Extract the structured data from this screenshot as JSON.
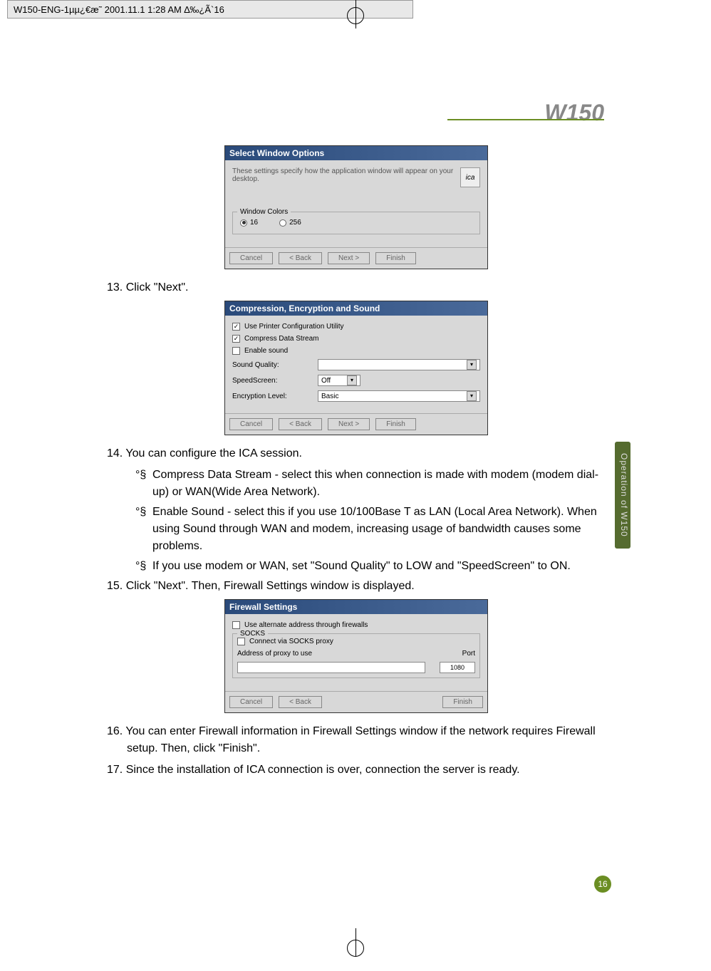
{
  "header": {
    "filename": "W150-ENG-1µµ¿€æ˜   2001.11.1 1:28 AM  ∆‰¿Ã`16"
  },
  "model": "W150",
  "sideTab": "Operation of W150",
  "pageNumber": "16",
  "dialog1": {
    "title": "Select Window Options",
    "description": "These settings specify how the application window will appear on your desktop.",
    "icaLabel": "ica",
    "groupLabel": "Window Colors",
    "radio16": "16",
    "radio256": "256",
    "btnCancel": "Cancel",
    "btnBack": "< Back",
    "btnNext": "Next >",
    "btnFinish": "Finish"
  },
  "step13": "13. Click \"Next\".",
  "dialog2": {
    "title": "Compression, Encryption and Sound",
    "check1": "Use Printer Configuration Utility",
    "check2": "Compress Data Stream",
    "check3": "Enable sound",
    "labelSound": "Sound Quality:",
    "labelSpeed": "SpeedScreen:",
    "labelEncrypt": "Encryption Level:",
    "valSpeed": "Off",
    "valEncrypt": "Basic",
    "btnCancel": "Cancel",
    "btnBack": "< Back",
    "btnNext": "Next >",
    "btnFinish": "Finish"
  },
  "step14": "14. You can configure the ICA session.",
  "bullet1marker": "°§",
  "bullet1": "Compress Data Stream  -  select this when connection is made with modem (modem dial-up) or WAN(Wide Area Network).",
  "bullet2marker": "°§",
  "bullet2": "Enable Sound  -  select this if you use 10/100Base T as LAN (Local Area Network). When using Sound through WAN and modem, increasing usage of bandwidth causes some problems.",
  "bullet3marker": "°§",
  "bullet3": "If you use modem or WAN, set \"Sound Quality\" to LOW and \"SpeedScreen\" to ON.",
  "step15": "15. Click \"Next\".  Then, Firewall Settings window is displayed.",
  "dialog3": {
    "title": "Firewall Settings",
    "check1": "Use alternate address through firewalls",
    "groupLabel": "SOCKS",
    "check2": "Connect via SOCKS proxy",
    "labelAddr": "Address of proxy to use",
    "labelPort": "Port",
    "valPort": "1080",
    "btnCancel": "Cancel",
    "btnBack": "< Back",
    "btnFinish": "Finish"
  },
  "step16": "16. You can enter Firewall information in Firewall Settings window if the network requires Firewall setup. Then, click \"Finish\".",
  "step17": "17. Since the installation of ICA connection is over, connection the server is ready."
}
